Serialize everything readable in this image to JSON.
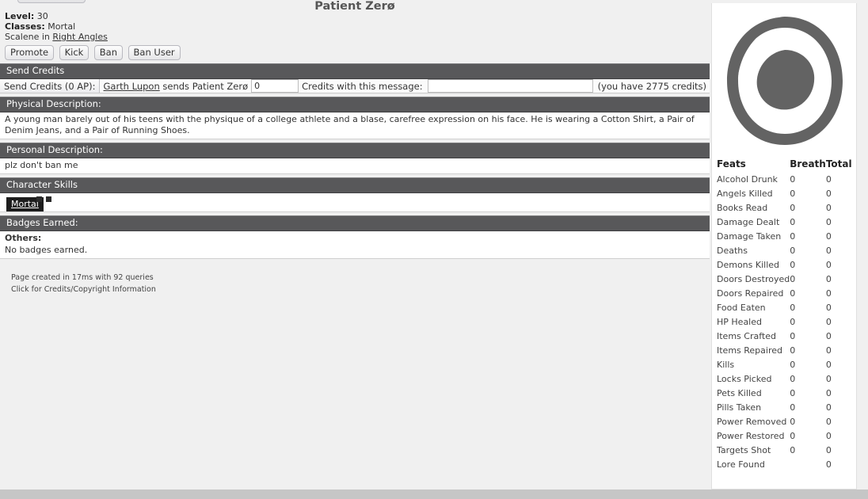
{
  "title": "Patient Zerø",
  "top_partial_button": {
    "label": ""
  },
  "character": {
    "level_label": "Level:",
    "level_value": "30",
    "classes_label": "Classes:",
    "classes_value": "Mortal",
    "group_prefix": "Scalene in",
    "group_link": "Right Angles"
  },
  "actions": {
    "promote": "Promote",
    "kick": "Kick",
    "ban": "Ban",
    "ban_user": "Ban User"
  },
  "send_credits": {
    "header": "Send Credits",
    "button_label": "Send Credits (0 AP):",
    "sender_link": "Garth Lupon",
    "sends_text": "sends Patient Zerø",
    "amount_value": "0",
    "message_label": "Credits with this message:",
    "message_value": "",
    "balance_text": "(you have 2775 credits)"
  },
  "physical_description": {
    "header": "Physical Description:",
    "text": "A young man barely out of his teens with the physique of a college athlete and a blase, carefree expression on his face. He is wearing a Cotton Shirt, a Pair of Denim Jeans, and a Pair of Running Shoes."
  },
  "personal_description": {
    "header": "Personal Description:",
    "text": "plz don't ban me"
  },
  "character_skills": {
    "header": "Character Skills",
    "tab_label": "Mortal"
  },
  "badges": {
    "header": "Badges Earned:",
    "others_label": "Others:",
    "empty_text": "No badges earned."
  },
  "footer": {
    "page_created": "Page created in 17ms with 92 queries",
    "credits_link": "Click for Credits/Copyright Information"
  },
  "logo": {
    "name": "enso-circle-logo",
    "color": "#636363"
  },
  "stats": {
    "columns": [
      "Feats",
      "Breath",
      "Total"
    ],
    "rows": [
      {
        "name": "Alcohol Drunk",
        "breath": "0",
        "total": "0"
      },
      {
        "name": "Angels Killed",
        "breath": "0",
        "total": "0"
      },
      {
        "name": "Books Read",
        "breath": "0",
        "total": "0"
      },
      {
        "name": "Damage Dealt",
        "breath": "0",
        "total": "0"
      },
      {
        "name": "Damage Taken",
        "breath": "0",
        "total": "0"
      },
      {
        "name": "Deaths",
        "breath": "0",
        "total": "0"
      },
      {
        "name": "Demons Killed",
        "breath": "0",
        "total": "0"
      },
      {
        "name": "Doors Destroyed",
        "breath": "0",
        "total": "0"
      },
      {
        "name": "Doors Repaired",
        "breath": "0",
        "total": "0"
      },
      {
        "name": "Food Eaten",
        "breath": "0",
        "total": "0"
      },
      {
        "name": "HP Healed",
        "breath": "0",
        "total": "0"
      },
      {
        "name": "Items Crafted",
        "breath": "0",
        "total": "0"
      },
      {
        "name": "Items Repaired",
        "breath": "0",
        "total": "0"
      },
      {
        "name": "Kills",
        "breath": "0",
        "total": "0"
      },
      {
        "name": "Locks Picked",
        "breath": "0",
        "total": "0"
      },
      {
        "name": "Pets Killed",
        "breath": "0",
        "total": "0"
      },
      {
        "name": "Pills Taken",
        "breath": "0",
        "total": "0"
      },
      {
        "name": "Power Removed",
        "breath": "0",
        "total": "0"
      },
      {
        "name": "Power Restored",
        "breath": "0",
        "total": "0"
      },
      {
        "name": "Targets Shot",
        "breath": "0",
        "total": "0"
      },
      {
        "name": "Lore Found",
        "breath": "",
        "total": "0"
      }
    ]
  },
  "colors": {
    "section_header_bg": "#58585a",
    "page_bg": "#f0f0f0",
    "panel_bg": "#ffffff",
    "bottom_bar": "#c6c6c6"
  }
}
